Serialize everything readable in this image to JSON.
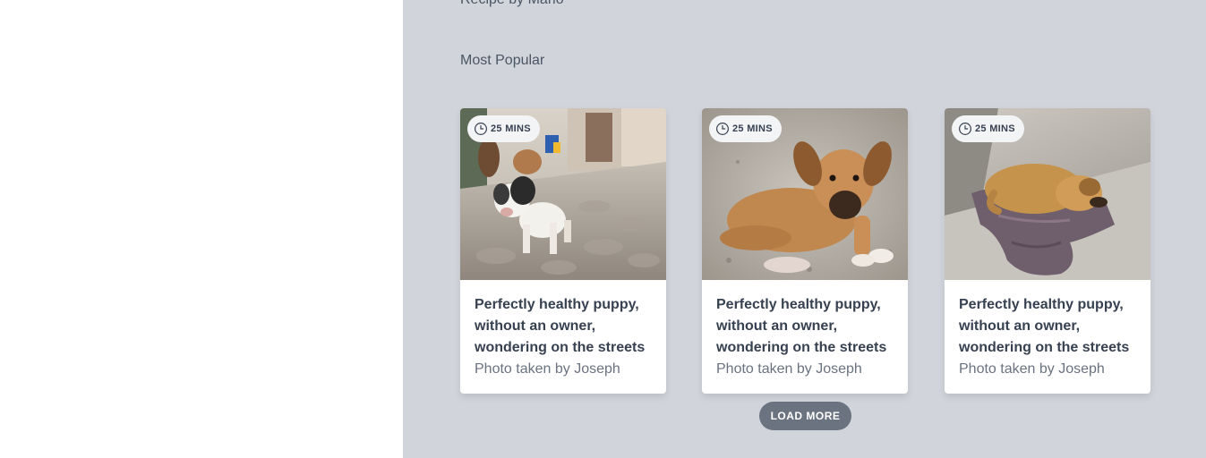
{
  "previous_section": {
    "caption": "Recipe by Mario"
  },
  "section": {
    "title": "Most Popular"
  },
  "cards": [
    {
      "time": "25 MINS",
      "title": "Perfectly healthy puppy, without an owner, wondering on the streets",
      "credit": "Photo taken by Joseph",
      "photo": "puppy-on-cobblestone-street"
    },
    {
      "time": "25 MINS",
      "title": "Perfectly healthy puppy, without an owner, wondering on the streets",
      "credit": "Photo taken by Joseph",
      "photo": "tan-puppy-lying-on-gravel"
    },
    {
      "time": "25 MINS",
      "title": "Perfectly healthy puppy, without an owner, wondering on the streets",
      "credit": "Photo taken by Joseph",
      "photo": "puppy-sleeping-on-cloth"
    }
  ],
  "load_more": {
    "label": "LOAD MORE"
  },
  "colors": {
    "panel_background": "#d1d5db",
    "card_background": "#ffffff",
    "button_background": "#6b7280",
    "title_text": "#374151",
    "muted_text": "#6b7280"
  },
  "icons": {
    "time": "clock-icon"
  }
}
